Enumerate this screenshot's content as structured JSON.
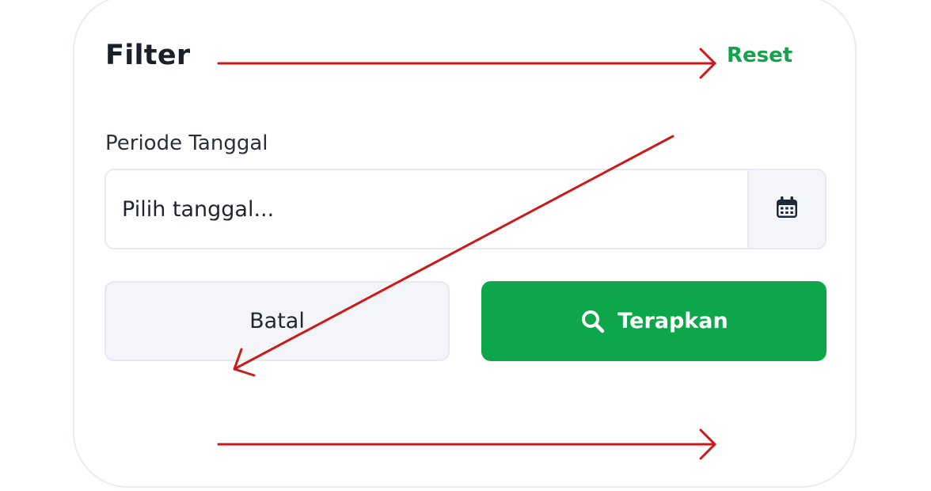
{
  "filter": {
    "title": "Filter",
    "reset_label": "Reset"
  },
  "date_period": {
    "label": "Periode Tanggal",
    "placeholder": "Pilih tanggal..."
  },
  "actions": {
    "cancel_label": "Batal",
    "apply_label": "Terapkan"
  },
  "icons": {
    "calendar": "calendar-icon",
    "search": "search-icon"
  },
  "colors": {
    "accent_green": "#0ea64b",
    "reset_green": "#11a44a",
    "annotation_red": "#cc1a1a",
    "text_dark": "#1b1f2a",
    "button_gray": "#f3f5f9"
  }
}
